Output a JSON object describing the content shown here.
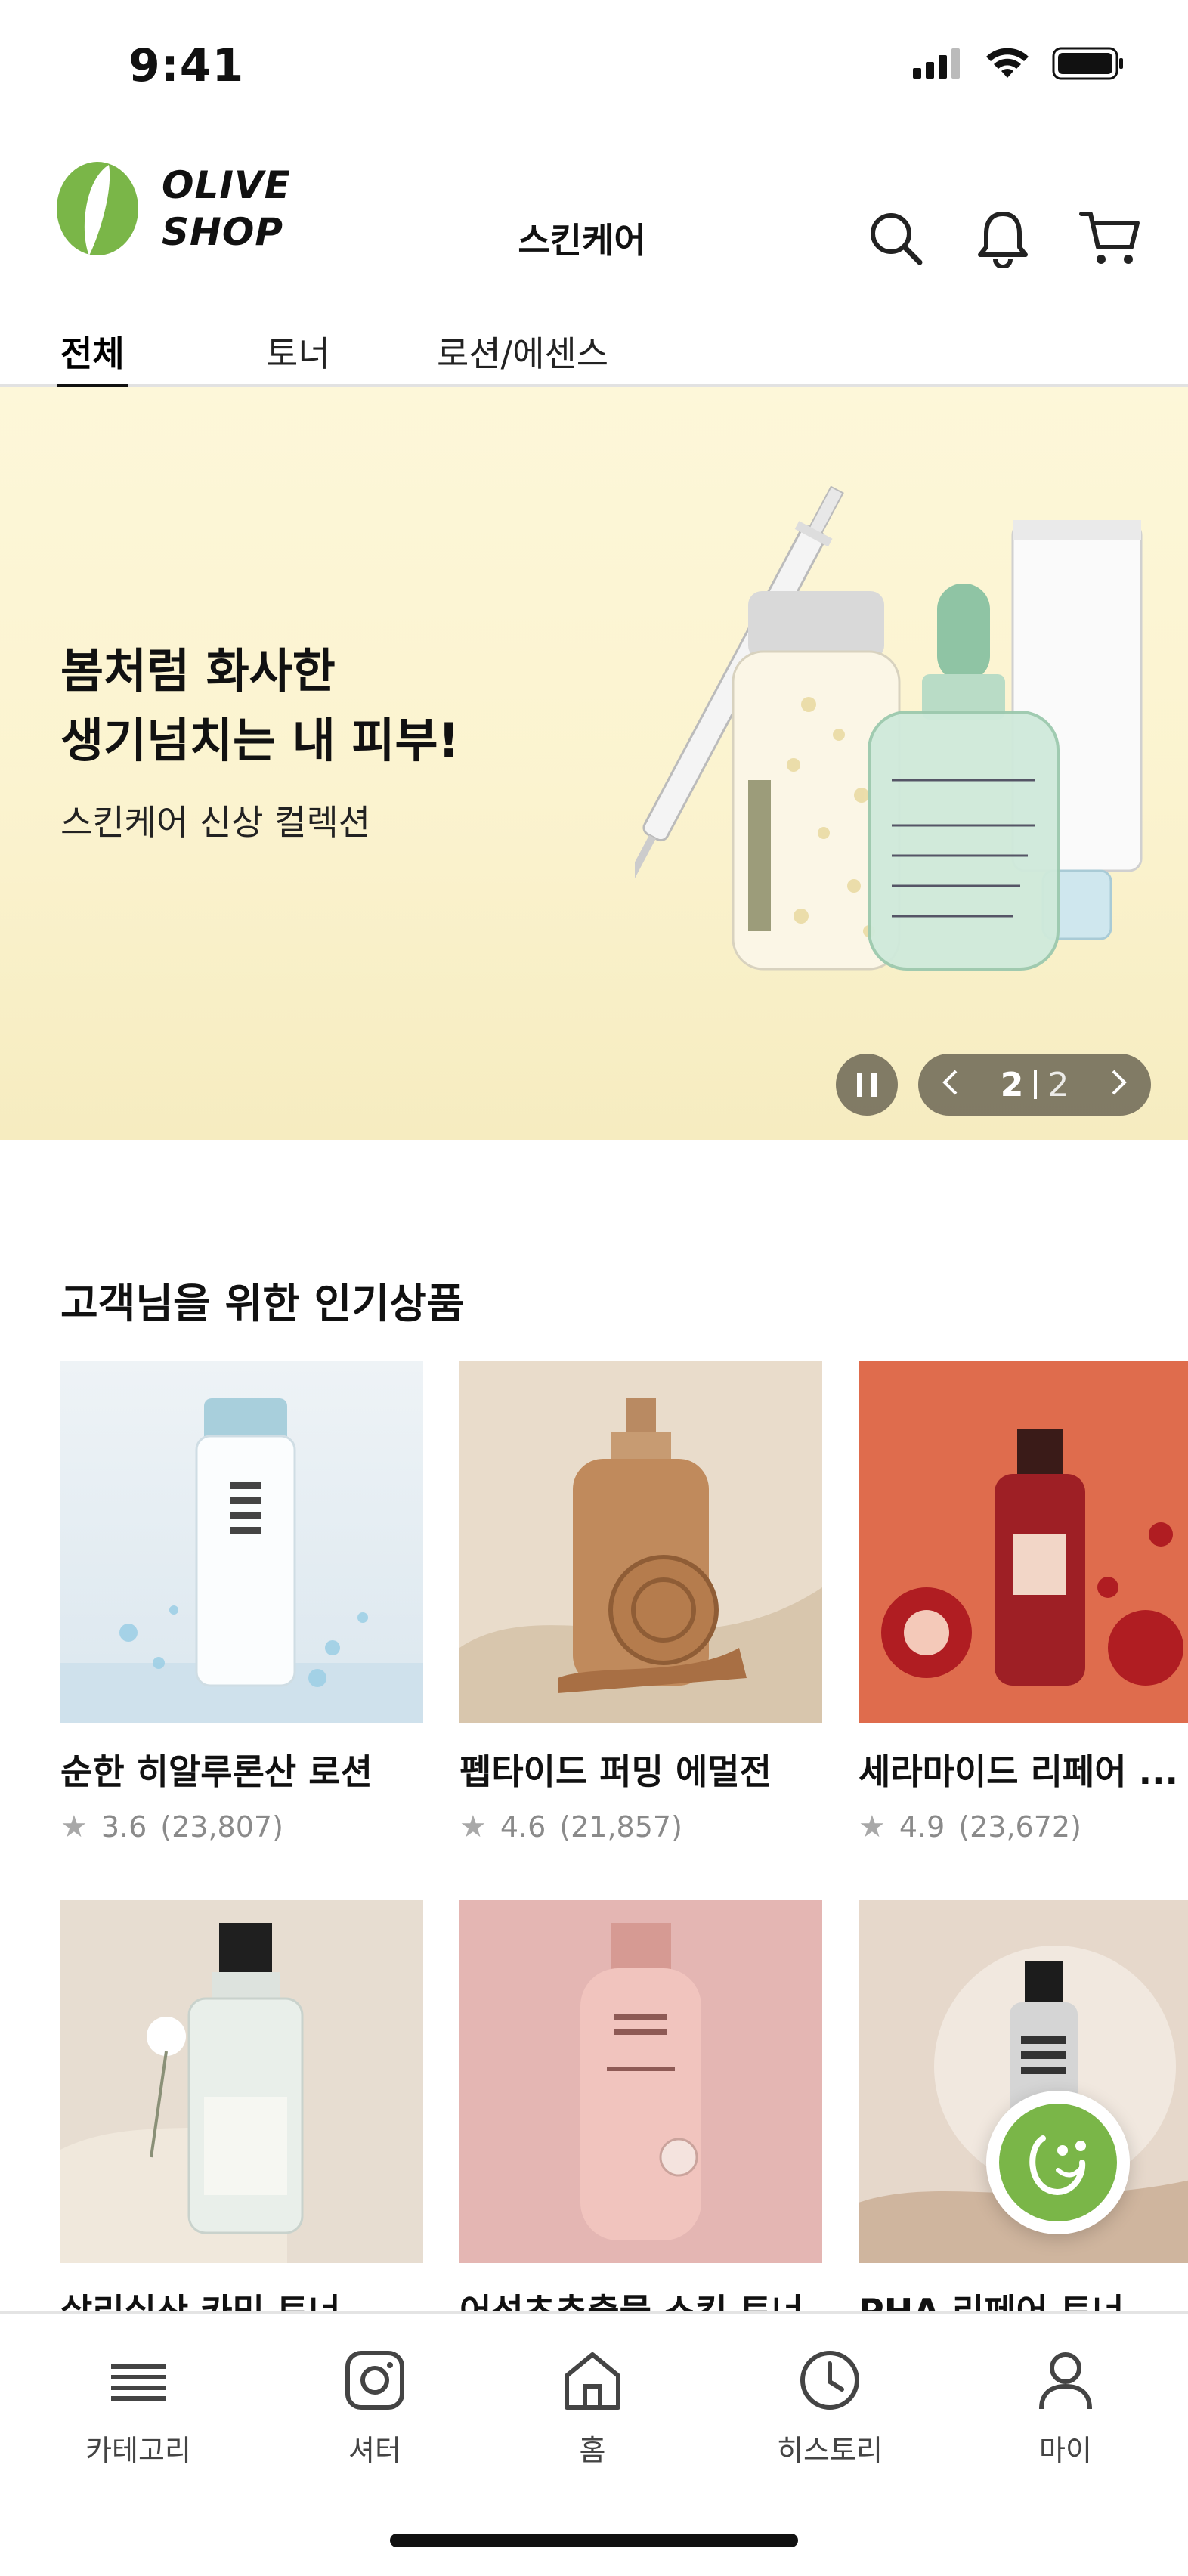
{
  "status_bar": {
    "time": "9:41"
  },
  "header": {
    "logo_line1": "OLIVE",
    "logo_line2": "SHOP",
    "title": "스킨케어",
    "icons": [
      "search-icon",
      "bell-icon",
      "cart-icon"
    ]
  },
  "tabs": [
    {
      "label": "전체",
      "active": true
    },
    {
      "label": "토너",
      "active": false
    },
    {
      "label": "로션/에센스",
      "active": false
    }
  ],
  "banner": {
    "headline_line1": "봄처럼 화사한",
    "headline_line2": "생기넘치는 내 피부!",
    "subtitle": "스킨케어 신상 컬렉션",
    "page_current": "2",
    "page_total": "2"
  },
  "section": {
    "title": "고객님을 위한 인기상품"
  },
  "products": [
    {
      "name": "순한 히알루론산 로션",
      "rating": "3.6",
      "reviews": "(23,807)"
    },
    {
      "name": "펩타이드 퍼밍 에멀전",
      "rating": "4.6",
      "reviews": "(21,857)"
    },
    {
      "name": "세라마이드 리페어 ...",
      "rating": "4.9",
      "reviews": "(23,672)"
    },
    {
      "name": "살리실산 카밍 토너",
      "rating": "",
      "reviews": ""
    },
    {
      "name": "어성초추출물 스킨 토너",
      "rating": "",
      "reviews": ""
    },
    {
      "name": "PHA 리페어 토너",
      "rating": "",
      "reviews": ""
    }
  ],
  "bottom_nav": [
    {
      "label": "카테고리",
      "icon": "menu-icon"
    },
    {
      "label": "셔터",
      "icon": "instagram-icon"
    },
    {
      "label": "홈",
      "icon": "home-icon"
    },
    {
      "label": "히스토리",
      "icon": "clock-icon"
    },
    {
      "label": "마이",
      "icon": "user-icon"
    }
  ],
  "colors": {
    "brand_green": "#7ab648",
    "banner_bg": "#fbf3cf"
  }
}
